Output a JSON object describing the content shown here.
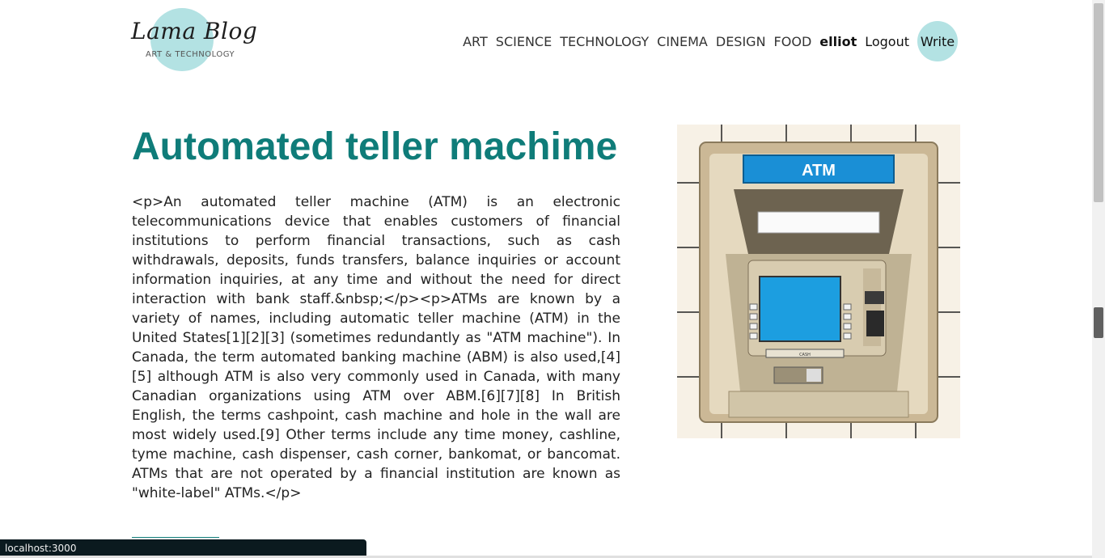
{
  "logo": {
    "title": "Lama Blog",
    "subtitle": "ART & TECHNOLOGY"
  },
  "nav": {
    "links": [
      "ART",
      "SCIENCE",
      "TECHNOLOGY",
      "CINEMA",
      "DESIGN",
      "FOOD"
    ],
    "user": "elliot",
    "logout": "Logout",
    "write": "Write"
  },
  "post": {
    "title": "Automated teller machime",
    "body": "<p>An automated teller machine (ATM) is an electronic telecommunications device that enables customers of financial institutions to perform financial transactions, such as cash withdrawals, deposits, funds transfers, balance inquiries or account information inquiries, at any time and without the need for direct interaction with bank staff.&nbsp;</p><p>ATMs are known by a variety of names, including automatic teller machine (ATM) in the United States[1][2][3] (sometimes redundantly as \"ATM machine\"). In Canada, the term automated banking machine (ABM) is also used,[4][5] although ATM is also very commonly used in Canada, with many Canadian organizations using ATM over ABM.[6][7][8] In British English, the terms cashpoint, cash machine and hole in the wall are most widely used.[9] Other terms include any time money, cashline, tyme machine, cash dispenser, cash corner, bankomat, or bancomat. ATMs that are not operated by a financial institution are known as \"white-label\" ATMs.</p>",
    "image_sign": "ATM",
    "image_slot_label": "CASH"
  },
  "status_bar": {
    "url": "localhost:3000"
  },
  "colors": {
    "accent": "#0f7c79",
    "logo_circle": "#b3e2e3"
  }
}
